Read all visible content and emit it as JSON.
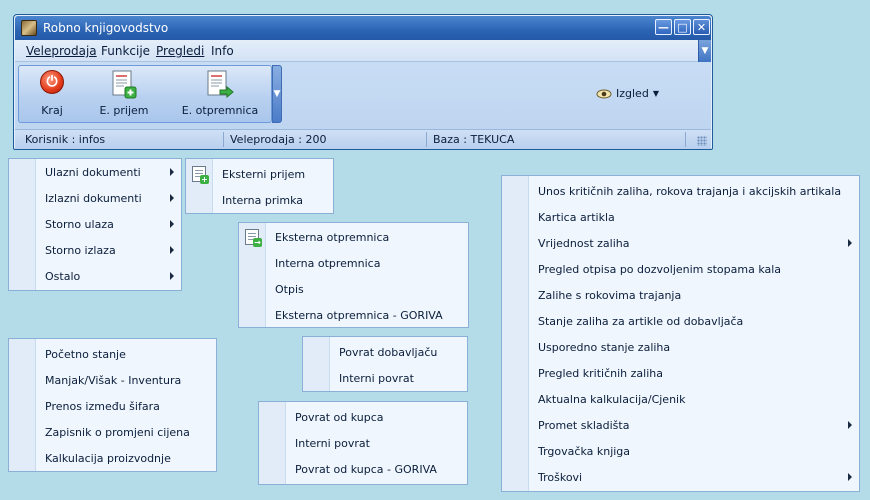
{
  "window": {
    "title": "Robno knjigovodstvo",
    "minimize_glyph": "—",
    "maximize_glyph": "□",
    "close_glyph": "✕"
  },
  "menubar": {
    "items": [
      {
        "label": "Veleprodaja"
      },
      {
        "label": "Funkcije"
      },
      {
        "label": "Pregledi"
      },
      {
        "label": "Info"
      }
    ]
  },
  "toolbar": {
    "buttons": [
      {
        "label": "Kraj",
        "icon": "power-icon"
      },
      {
        "label": "E. prijem",
        "icon": "document-add-icon"
      },
      {
        "label": "E. otpremnica",
        "icon": "document-send-icon"
      }
    ],
    "izgled_label": "Izgled"
  },
  "statusbar": {
    "korisnik": "Korisnik : infos",
    "veleprodaja": "Veleprodaja : 200",
    "baza": "Baza : TEKUCA"
  },
  "menu_main": {
    "items": [
      {
        "label": "Ulazni dokumenti",
        "submenu": true
      },
      {
        "label": "Izlazni dokumenti",
        "submenu": true
      },
      {
        "label": "Storno ulaza",
        "submenu": true
      },
      {
        "label": "Storno izlaza",
        "submenu": true
      },
      {
        "label": "Ostalo",
        "submenu": true
      }
    ]
  },
  "menu_ulazni": {
    "items": [
      {
        "label": "Eksterni prijem"
      },
      {
        "label": "Interna primka"
      }
    ]
  },
  "menu_izlazni": {
    "items": [
      {
        "label": "Eksterna otpremnica"
      },
      {
        "label": "Interna otpremnica"
      },
      {
        "label": "Otpis"
      },
      {
        "label": "Eksterna otpremnica - GORIVA"
      }
    ]
  },
  "menu_storno_ulaza": {
    "items": [
      {
        "label": "Povrat dobavljaču"
      },
      {
        "label": "Interni povrat"
      }
    ]
  },
  "menu_storno_izlaza": {
    "items": [
      {
        "label": "Povrat od kupca"
      },
      {
        "label": "Interni povrat"
      },
      {
        "label": "Povrat od kupca - GORIVA"
      }
    ]
  },
  "menu_ostalo": {
    "items": [
      {
        "label": "Početno stanje"
      },
      {
        "label": "Manjak/Višak - Inventura"
      },
      {
        "label": "Prenos između šifara"
      },
      {
        "label": "Zapisnik o promjeni cijena"
      },
      {
        "label": "Kalkulacija proizvodnje"
      }
    ]
  },
  "menu_pregledi": {
    "items": [
      {
        "label": "Unos kritičnih zaliha, rokova trajanja i akcijskih artikala"
      },
      {
        "label": "Kartica artikla"
      },
      {
        "label": "Vrijednost zaliha",
        "submenu": true
      },
      {
        "label": "Pregled otpisa po dozvoljenim stopama kala"
      },
      {
        "label": "Zalihe s rokovima trajanja"
      },
      {
        "label": "Stanje zaliha za artikle od dobavljača"
      },
      {
        "label": "Usporedno stanje zaliha"
      },
      {
        "label": "Pregled kritičnih zaliha"
      },
      {
        "label": "Aktualna kalkulacija/Cjenik"
      },
      {
        "label": "Promet skladišta",
        "submenu": true
      },
      {
        "label": "Trgovačka knjiga"
      },
      {
        "label": "Troškovi",
        "submenu": true
      }
    ]
  }
}
